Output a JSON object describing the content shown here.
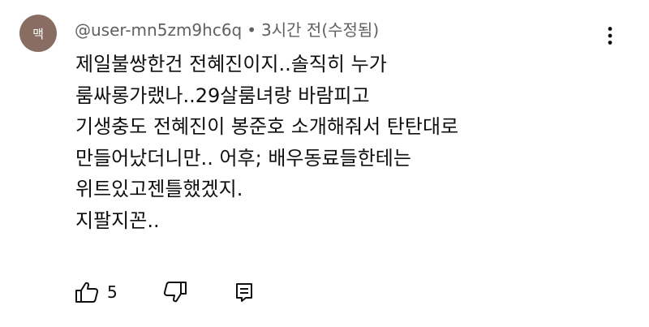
{
  "comment": {
    "avatar_initial": "맥",
    "avatar_color": "#8a6d62",
    "author": "@user-mn5zm9hc6q",
    "separator": "•",
    "time": "3시간 전(수정됨)",
    "body_lines": [
      "제일불쌍한건 전혜진이지..솔직히 누가",
      "룸싸롱가랬나..29살룸녀랑 바람피고",
      "기생충도 전혜진이 봉준호 소개해줘서 탄탄대로",
      "만들어났더니만.. 어후; 배우동료들한테는",
      "위트있고젠틀했겠지.",
      "지팔지꼰.."
    ],
    "like_count": "5",
    "icons": {
      "like": "thumbs-up-icon",
      "dislike": "thumbs-down-icon",
      "reply": "reply-comment-icon",
      "menu": "more-vertical-icon"
    }
  }
}
